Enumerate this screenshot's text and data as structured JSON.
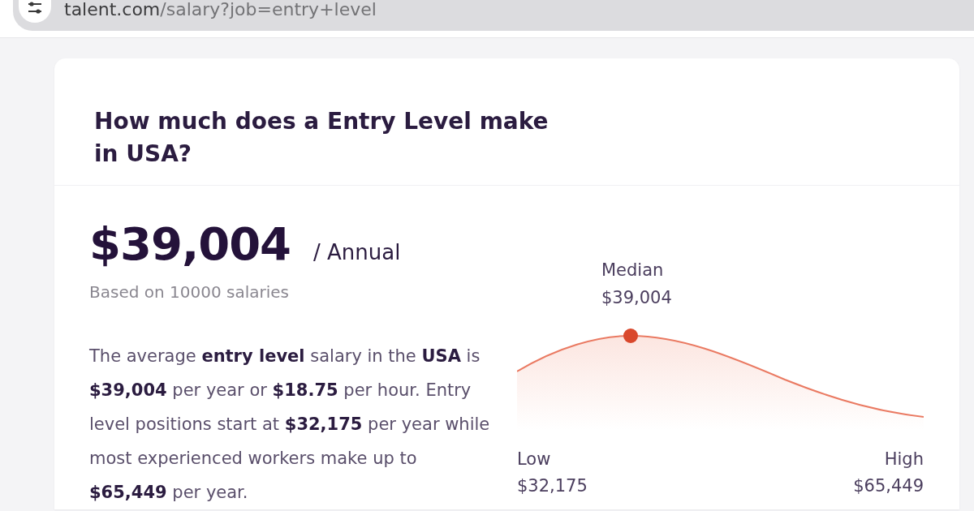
{
  "browser": {
    "address_host": "talent.com",
    "address_path": "/salary?job=entry+level"
  },
  "card": {
    "title": "How much does a Entry Level make in USA?",
    "salary": "$39,004",
    "period": "/ Annual",
    "basis": "Based on 10000 salaries",
    "summary": "The average **entry level** salary in the **USA** is **$39,004** per year or **$18.75** per hour. Entry level positions start at **$32,175** per year while most experienced workers make up to **$65,449** per year.",
    "distribution": {
      "median": {
        "label": "Median",
        "value": "$39,004"
      },
      "low": {
        "label": "Low",
        "value": "$32,175"
      },
      "high": {
        "label": "High",
        "value": "$65,449"
      }
    }
  }
}
